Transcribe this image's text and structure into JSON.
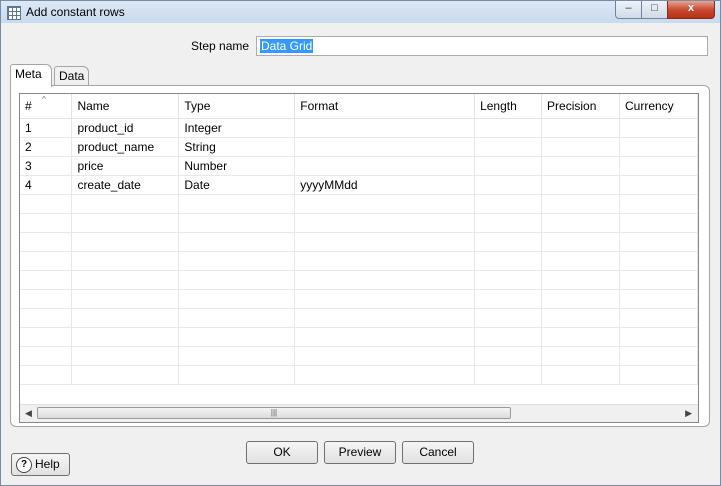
{
  "window": {
    "title": "Add constant rows",
    "minimize": "–",
    "maximize": "□",
    "close": "x"
  },
  "step": {
    "label": "Step name",
    "value": "Data Grid"
  },
  "tabs": [
    {
      "label": "Meta",
      "active": true
    },
    {
      "label": "Data",
      "active": false
    }
  ],
  "grid": {
    "headers": [
      "#",
      "Name",
      "Type",
      "Format",
      "Length",
      "Precision",
      "Currency"
    ],
    "rows": [
      [
        "1",
        "product_id",
        "Integer",
        "",
        "",
        "",
        ""
      ],
      [
        "2",
        "product_name",
        "String",
        "",
        "",
        "",
        ""
      ],
      [
        "3",
        "price",
        "Number",
        "",
        "",
        "",
        ""
      ],
      [
        "4",
        "create_date",
        "Date",
        "yyyyMMdd",
        "",
        "",
        ""
      ]
    ],
    "empty_rows": 10,
    "scroll_left": "◀",
    "scroll_right": "▶",
    "scroll_grip": "|||"
  },
  "buttons": {
    "ok": "OK",
    "preview": "Preview",
    "cancel": "Cancel",
    "help": "Help"
  }
}
